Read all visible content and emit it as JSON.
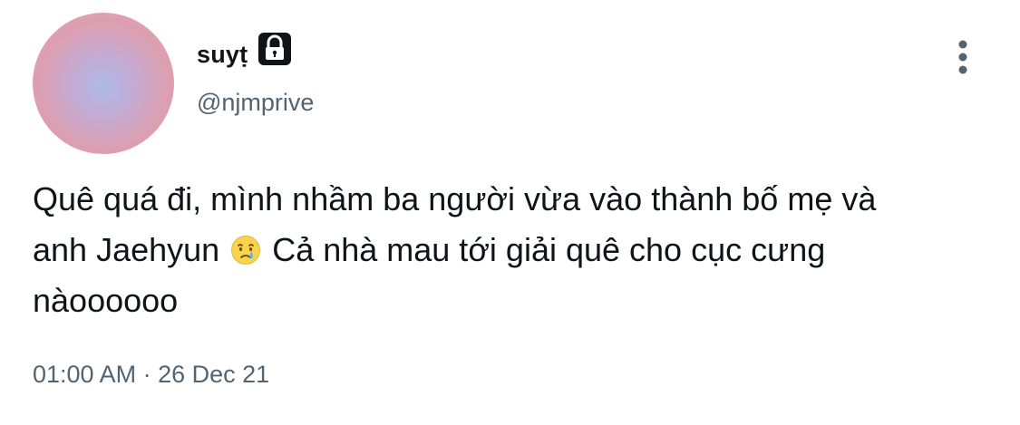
{
  "tweet": {
    "display_name": "suyṭ",
    "username": "@njmprive",
    "text_part1": "Quê quá đi, mình nhầm ba người vừa vào thành bố mẹ và\nanh Jaehyun ",
    "text_part2": " Cả nhà mau tới giải quê cho cục cưng\nnàoooooo",
    "emoji_icon": "crying-face-emoji-icon",
    "timestamp": "01:00 AM · 26 Dec 21",
    "lock_icon": "lock-icon",
    "more_icon": "more-vertical-icon"
  }
}
